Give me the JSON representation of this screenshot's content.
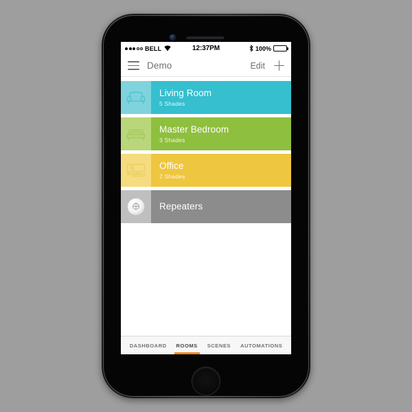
{
  "device": {
    "name": "iphone-black",
    "earpiece": "speaker-grille",
    "camera": "front-camera",
    "home_button_label": "Home"
  },
  "status_bar": {
    "carrier": "BELL",
    "signal_filled": 3,
    "signal_empty": 2,
    "wifi_icon": "wifi-icon",
    "time": "12:37PM",
    "bluetooth_icon": "bluetooth-icon",
    "battery_percent": "100%",
    "battery_icon": "battery-full-icon"
  },
  "nav_bar": {
    "menu_icon": "hamburger-menu-icon",
    "title": "Demo",
    "edit_label": "Edit",
    "add_icon": "plus-icon"
  },
  "rooms": [
    {
      "name": "Living Room",
      "subtitle": "5 Shades",
      "icon": "armchair-icon",
      "color": "#35BFCF",
      "icon_panel_color": "#7FD3DC"
    },
    {
      "name": "Master Bedroom",
      "subtitle": "3 Shades",
      "icon": "bed-icon",
      "color": "#8FBF3F",
      "icon_panel_color": "#B9D67B"
    },
    {
      "name": "Office",
      "subtitle": "2 Shades",
      "icon": "desktop-computer-icon",
      "color": "#EFC63F",
      "icon_panel_color": "#F5DC7E"
    },
    {
      "name": "Repeaters",
      "subtitle": "",
      "icon": "repeater-puck-icon",
      "color": "#8C8C8C",
      "icon_panel_color": "#BFBFBF"
    }
  ],
  "tab_bar": {
    "active_color": "#F0891F",
    "tabs": [
      {
        "label": "DASHBOARD",
        "active": false
      },
      {
        "label": "ROOMS",
        "active": true
      },
      {
        "label": "SCENES",
        "active": false
      },
      {
        "label": "AUTOMATIONS",
        "active": false
      }
    ]
  }
}
